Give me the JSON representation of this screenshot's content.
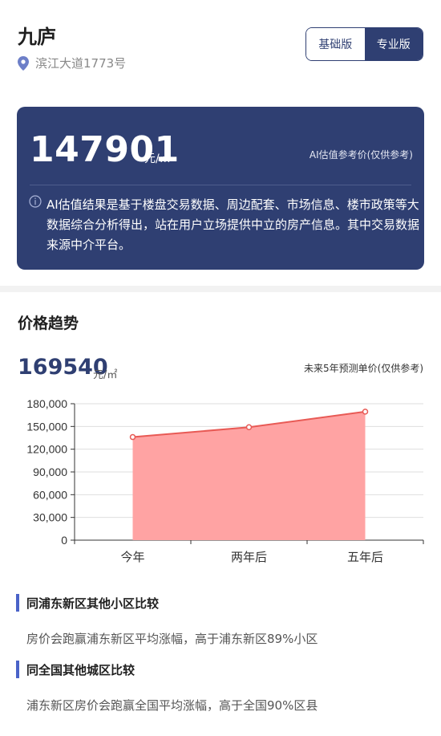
{
  "header": {
    "title": "九庐",
    "address": "滨江大道1773号",
    "toggle": {
      "basic_label": "基础版",
      "pro_label": "专业版"
    }
  },
  "valuation": {
    "price": "147901",
    "unit": "元/㎡",
    "ref_label": "AI估值参考价(仅供参考)",
    "disclaimer": "AI估值结果是基于楼盘交易数据、周边配套、市场信息、楼市政策等大数据综合分析得出，站在用户立场提供中立的房产信息。其中交易数据来源中介平台。"
  },
  "trend": {
    "title": "价格趋势",
    "future_price": "169540",
    "unit": "元/㎡",
    "ref_label": "未来5年预测单价(仅供参考)"
  },
  "chart_data": {
    "type": "area",
    "categories": [
      "今年",
      "两年后",
      "五年后"
    ],
    "values": [
      136000,
      149000,
      169540
    ],
    "yticks": [
      "0",
      "30,000",
      "60,000",
      "90,000",
      "120,000",
      "150,000",
      "180,000"
    ],
    "ylim": [
      0,
      180000
    ],
    "grid": true,
    "line_color": "#e85a55",
    "fill_color": "#ffa3a3"
  },
  "comparisons": [
    {
      "title": "同浦东新区其他小区比较",
      "text": "房价会跑赢浦东新区平均涨幅，高于浦东新区89%小区"
    },
    {
      "title": "同全国其他城区比较",
      "text": "浦东新区房价会跑赢全国平均涨幅，高于全国90%区县"
    }
  ],
  "colors": {
    "primary": "#2f3f72",
    "accent": "#4a63c8"
  }
}
